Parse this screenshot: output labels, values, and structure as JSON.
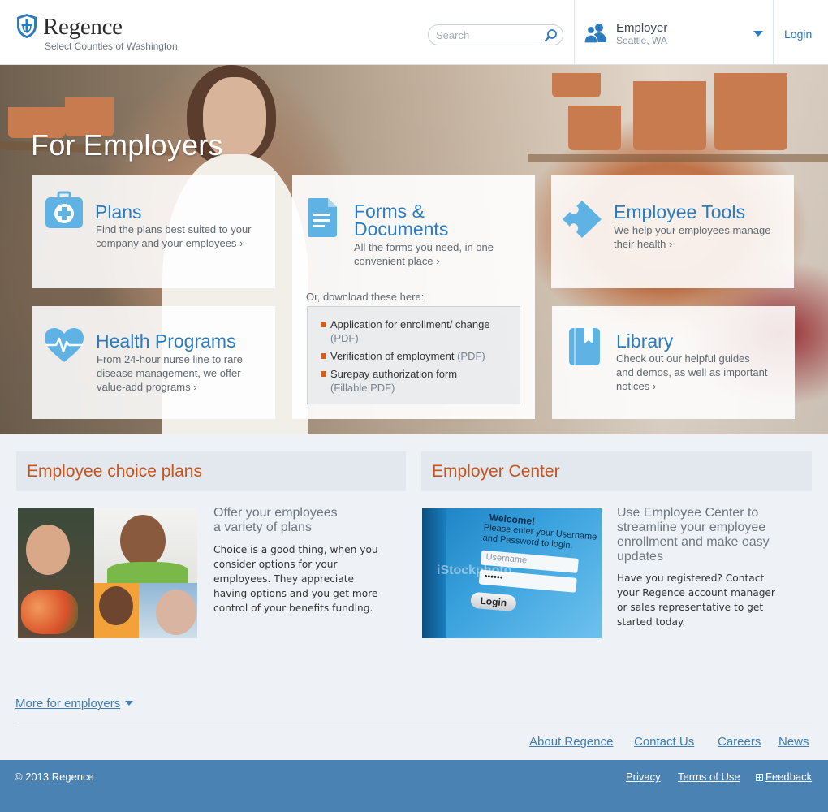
{
  "header": {
    "logo_name": "Regence",
    "logo_sub": "Select Counties of Washington",
    "search_placeholder": "Search",
    "employer_title": "Employer",
    "employer_location": "Seattle, WA",
    "login_label": "Login"
  },
  "hero": {
    "title": "For Employers",
    "cards": {
      "plans": {
        "title": "Plans",
        "desc": "Find the plans best suited to your company and your employees"
      },
      "forms": {
        "title_line1": "Forms &",
        "title_line2": "Documents",
        "desc": "All the forms you need, in one convenient place"
      },
      "tools": {
        "title": "Employee Tools",
        "desc": "We help your employees manage their health"
      },
      "health": {
        "title": "Health Programs",
        "desc": "From 24-hour nurse line to rare disease management, we offer value-add programs"
      },
      "library": {
        "title": "Library",
        "desc": "Check out our helpful guides and demos, as well as important notices"
      }
    },
    "downloads": {
      "label": "Or, download these here:",
      "items": [
        {
          "name": "Application for enrollment/ change",
          "type": "(PDF)"
        },
        {
          "name": "Verification of employment",
          "type": "(PDF)"
        },
        {
          "name": "Surepay authorization form",
          "type": "(Fillable PDF)"
        }
      ]
    }
  },
  "sections": {
    "choice": {
      "title": "Employee choice plans",
      "subtitle_line1": "Offer your employees",
      "subtitle_line2": "a variety of plans",
      "body": "Choice is a good thing, when you consider options for your employees. They appreciate having options and you get more control of your benefits funding."
    },
    "center": {
      "title": "Employer Center",
      "subtitle": "Use Employee Center to streamline your employee enrollment and make easy updates",
      "body": "Have you registered? Contact your Regence account manager or sales representative to get started today.",
      "screen": {
        "welcome": "Welcome!",
        "prompt_line1": "Please enter your Username",
        "prompt_line2": "and Password to login.",
        "username_placeholder": "Username",
        "password_mask": "••••••",
        "button": "Login",
        "watermark": "iStockphoto"
      }
    }
  },
  "more_link": "More for employers",
  "footer_links": [
    "About Regence",
    "Contact Us",
    "Careers",
    "News"
  ],
  "footer": {
    "copyright": "© 2013 Regence",
    "privacy": "Privacy",
    "terms": "Terms of Use",
    "feedback": "Feedback"
  },
  "colors": {
    "brand_blue": "#2a7bbf",
    "accent_orange": "#c9531a",
    "footer_blue": "#4a82b4"
  }
}
